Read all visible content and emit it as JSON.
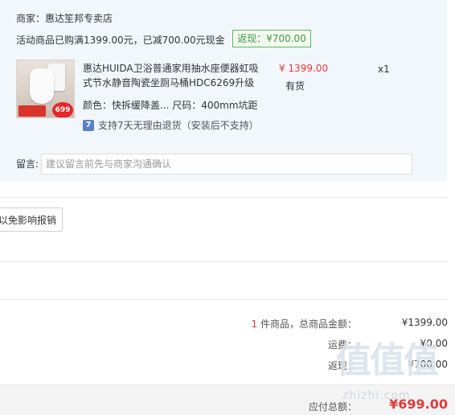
{
  "merchant": {
    "label": "商家：惠达笙邦专卖店"
  },
  "promo": {
    "text": "活动商品已购满1399.00元，已减700.00元现金",
    "badge": "返现：¥700.00"
  },
  "product": {
    "name": "惠达HUIDA卫浴普通家用抽水座便器虹吸式节水静音陶瓷坐厕马桶HDC6269升级",
    "price": "¥ 1399.00",
    "stock": "有货",
    "quantity": "x1",
    "attributes": "颜色：快拆缓降盖... 尺码：400mm坑距",
    "thumb_badge": "699",
    "return_policy": "支持7天无理由退货（安装后不支持）",
    "return_icon": "7"
  },
  "message": {
    "label": "留言:",
    "placeholder": "建议留言前先与商家沟通确认",
    "value": ""
  },
  "report_button": "以免影响报销",
  "summary": {
    "count": "1",
    "items_label": " 件商品，总商品金额：",
    "items_total": "¥1399.00",
    "shipping_label": "运费：",
    "shipping_value": "¥0.00",
    "rebate_label": "返现：",
    "rebate_value": "¥700.00"
  },
  "payable": {
    "label": "应付总额：",
    "value": "¥699.00"
  },
  "watermark": {
    "glyphs": "值值值",
    "text": "zhizhi.com"
  },
  "colors": {
    "accent_red": "#e4393c",
    "badge_green": "#5cb85c",
    "panel_bg": "#f2f7fc"
  }
}
